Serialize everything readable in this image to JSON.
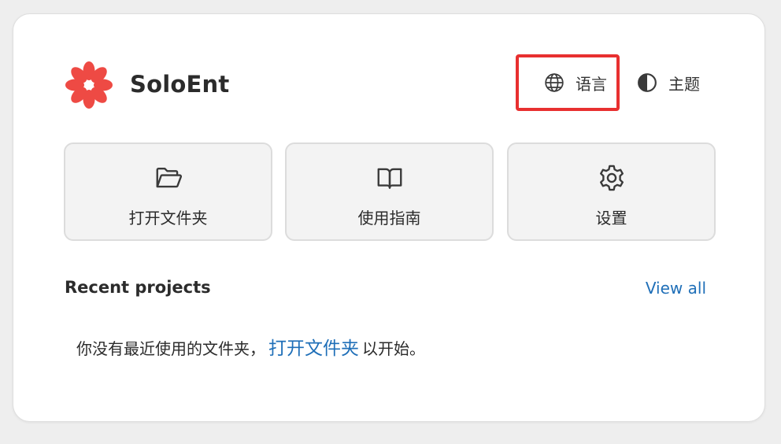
{
  "app": {
    "title": "SoloEnt",
    "logo_color": "#ee4a44"
  },
  "header": {
    "language_label": "语言",
    "theme_label": "主题",
    "highlight_color": "#e83030"
  },
  "actions": [
    {
      "label": "打开文件夹",
      "icon": "folder-open-icon"
    },
    {
      "label": "使用指南",
      "icon": "book-open-icon"
    },
    {
      "label": "设置",
      "icon": "gear-icon"
    }
  ],
  "recent": {
    "title": "Recent projects",
    "view_all": "View all",
    "empty_prefix": "你没有最近使用的文件夹，",
    "empty_link": "打开文件夹",
    "empty_suffix": "以开始。",
    "link_color": "#1f6fb8"
  }
}
